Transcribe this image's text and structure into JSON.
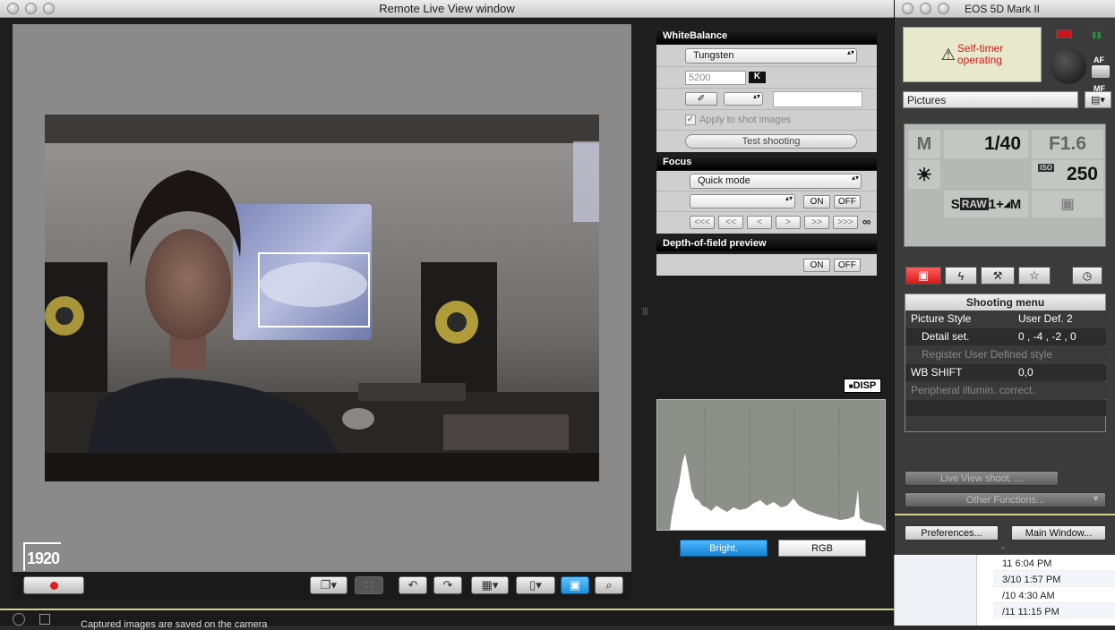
{
  "liveview": {
    "title": "Remote Live View window",
    "resolution_badge": "1920",
    "record_label": "record"
  },
  "whitebalance": {
    "header": "WhiteBalance",
    "mode": "Tungsten",
    "kelvin_value": "5200",
    "kelvin_unit": "K",
    "apply_label": "Apply to shot images",
    "test_label": "Test shooting"
  },
  "focus": {
    "header": "Focus",
    "mode": "Quick mode",
    "on_label": "ON",
    "off_label": "OFF",
    "steps": [
      "<<<",
      "<<",
      "<",
      ">",
      ">>",
      ">>>"
    ],
    "infinity": "∞"
  },
  "dof": {
    "header": "Depth-of-field preview",
    "on_label": "ON",
    "off_label": "OFF"
  },
  "histogram": {
    "disp_label": "DISP",
    "bright_label": "Bright.",
    "rgb_label": "RGB"
  },
  "eos": {
    "title": "EOS 5D Mark II",
    "warning_line1": "Self-timer",
    "warning_line2": "operating",
    "af_label": "AF",
    "mf_label": "MF",
    "folder": "Pictures",
    "mode": "M",
    "shutter": "1/40",
    "aperture": "F1.6",
    "iso_label": "ISO",
    "iso": "250",
    "quality_s": "S",
    "quality_raw": "RAW",
    "quality_rest": "1+",
    "quality_m": "M",
    "menu_title": "Shooting menu",
    "menu_rows": [
      {
        "label": "Picture Style",
        "value": "User Def. 2"
      },
      {
        "label": "Detail set.",
        "value": "0 , -4 , -2 , 0"
      },
      {
        "label": "Register User Defined style",
        "value": ""
      },
      {
        "label": "WB SHIFT",
        "value": "0,0"
      },
      {
        "label": "Peripheral illumin. correct.",
        "value": ""
      }
    ],
    "liveview_shoot": "Live View shoot. ...",
    "other_functions": "Other Functions...",
    "preferences": "Preferences...",
    "main_window": "Main Window..."
  },
  "background_dates": [
    "11 6:04 PM",
    "3/10 1:57 PM",
    "/10 4:30 AM",
    "/11 11:15 PM"
  ],
  "statusbar": "Captured images are saved on the camera"
}
